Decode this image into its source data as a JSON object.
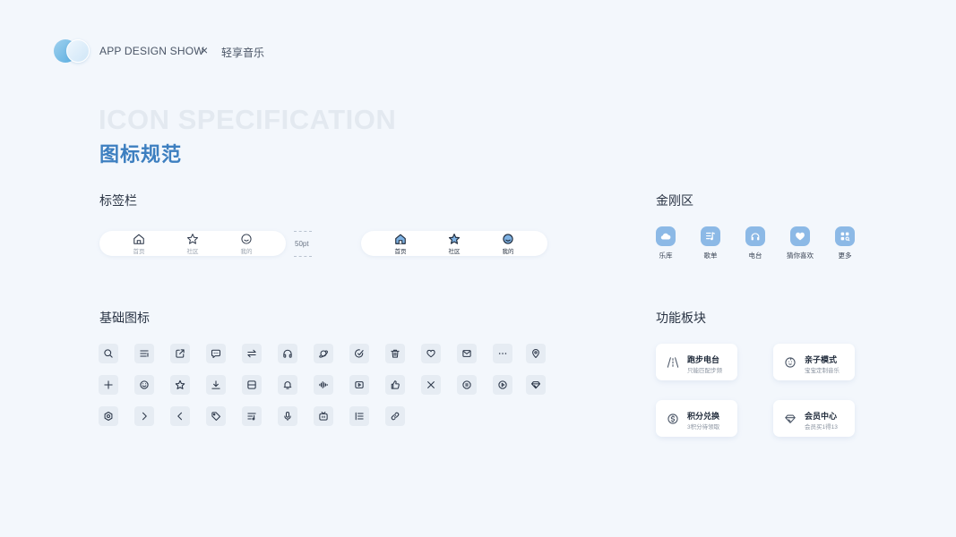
{
  "header": {
    "show_text": "APP DESIGN SHOW",
    "separator": "×",
    "brand": "轻享音乐"
  },
  "title": {
    "en": "ICON SPECIFICATION",
    "cn": "图标规范"
  },
  "sections": {
    "tabbar": "标签栏",
    "kingkong": "金刚区",
    "basic": "基础图标",
    "function": "功能板块"
  },
  "tabbar": {
    "spec": "50pt",
    "items": [
      {
        "label": "首页",
        "icon": "home-icon"
      },
      {
        "label": "社区",
        "icon": "star-icon"
      },
      {
        "label": "我的",
        "icon": "smile-icon"
      }
    ]
  },
  "kingkong": {
    "items": [
      {
        "label": "乐库",
        "icon": "cloud-icon"
      },
      {
        "label": "歌单",
        "icon": "playlist-icon"
      },
      {
        "label": "电台",
        "icon": "radio-icon"
      },
      {
        "label": "猜你喜欢",
        "icon": "heart-icon"
      },
      {
        "label": "更多",
        "icon": "more-grid-icon"
      }
    ]
  },
  "function": {
    "cards": [
      {
        "title": "跑步电台",
        "sub": "只能匹配步频",
        "icon": "road-icon"
      },
      {
        "title": "亲子模式",
        "sub": "宝宝定制音乐",
        "icon": "baby-icon"
      },
      {
        "title": "积分兑换",
        "sub": "3积分待领取",
        "icon": "coin-icon"
      },
      {
        "title": "会员中心",
        "sub": "会员买1得13",
        "icon": "diamond-icon"
      }
    ]
  },
  "colors": {
    "background": "#f3f7fc",
    "accent": "#3d7fc0",
    "kingkong_bg": "#8cb9e6",
    "tile_bg": "#e6ecf3"
  },
  "basic_icons": [
    "search-icon",
    "list-icon",
    "share-icon",
    "comment-icon",
    "switch-icon",
    "headphones-icon",
    "planet-icon",
    "edit-check-icon",
    "trash-icon",
    "heart-icon",
    "mail-icon",
    "more-icon",
    "location-icon",
    "plus-icon",
    "smile-icon",
    "star-icon",
    "download-icon",
    "scan-icon",
    "bell-icon",
    "waveform-icon",
    "video-icon",
    "thumbs-up-icon",
    "close-icon",
    "pause-icon",
    "play-icon",
    "diamond-icon",
    "settings-icon",
    "chevron-right-icon",
    "chevron-left-icon",
    "tag-icon",
    "queue-icon",
    "microphone-icon",
    "tv-icon",
    "numbered-list-icon",
    "link-icon"
  ]
}
